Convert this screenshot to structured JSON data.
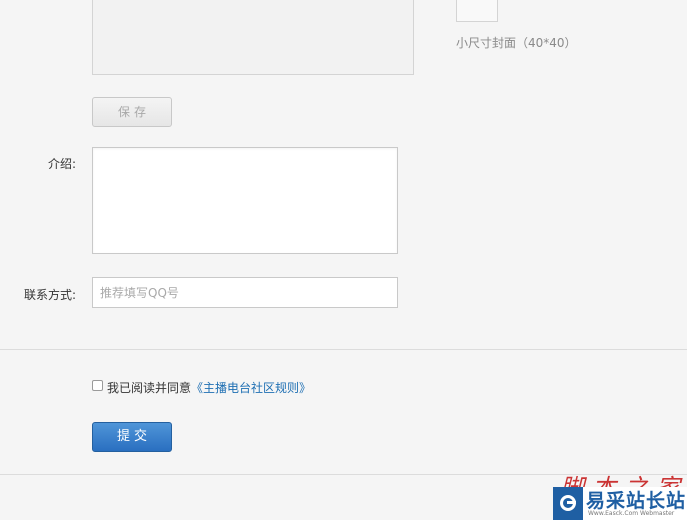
{
  "cover": {
    "small_caption": "小尺寸封面（40*40）"
  },
  "save_button": "保存",
  "fields": {
    "intro_label": "介绍:",
    "contact_label": "联系方式:",
    "contact_placeholder": "推荐填写QQ号"
  },
  "agreement": {
    "text": "我已阅读并同意",
    "link": "《主播电台社区规则》",
    "checked": false
  },
  "submit_button": "提交",
  "watermark": {
    "top_text": "脚本之家",
    "logo_text": "易采站长站",
    "url": "Www.Easck.Com  Webmaster"
  },
  "colors": {
    "accent": "#2a6fc0",
    "link": "#1e6fb3",
    "watermark_red": "#c72020",
    "watermark_blue": "#1f5fa3"
  }
}
